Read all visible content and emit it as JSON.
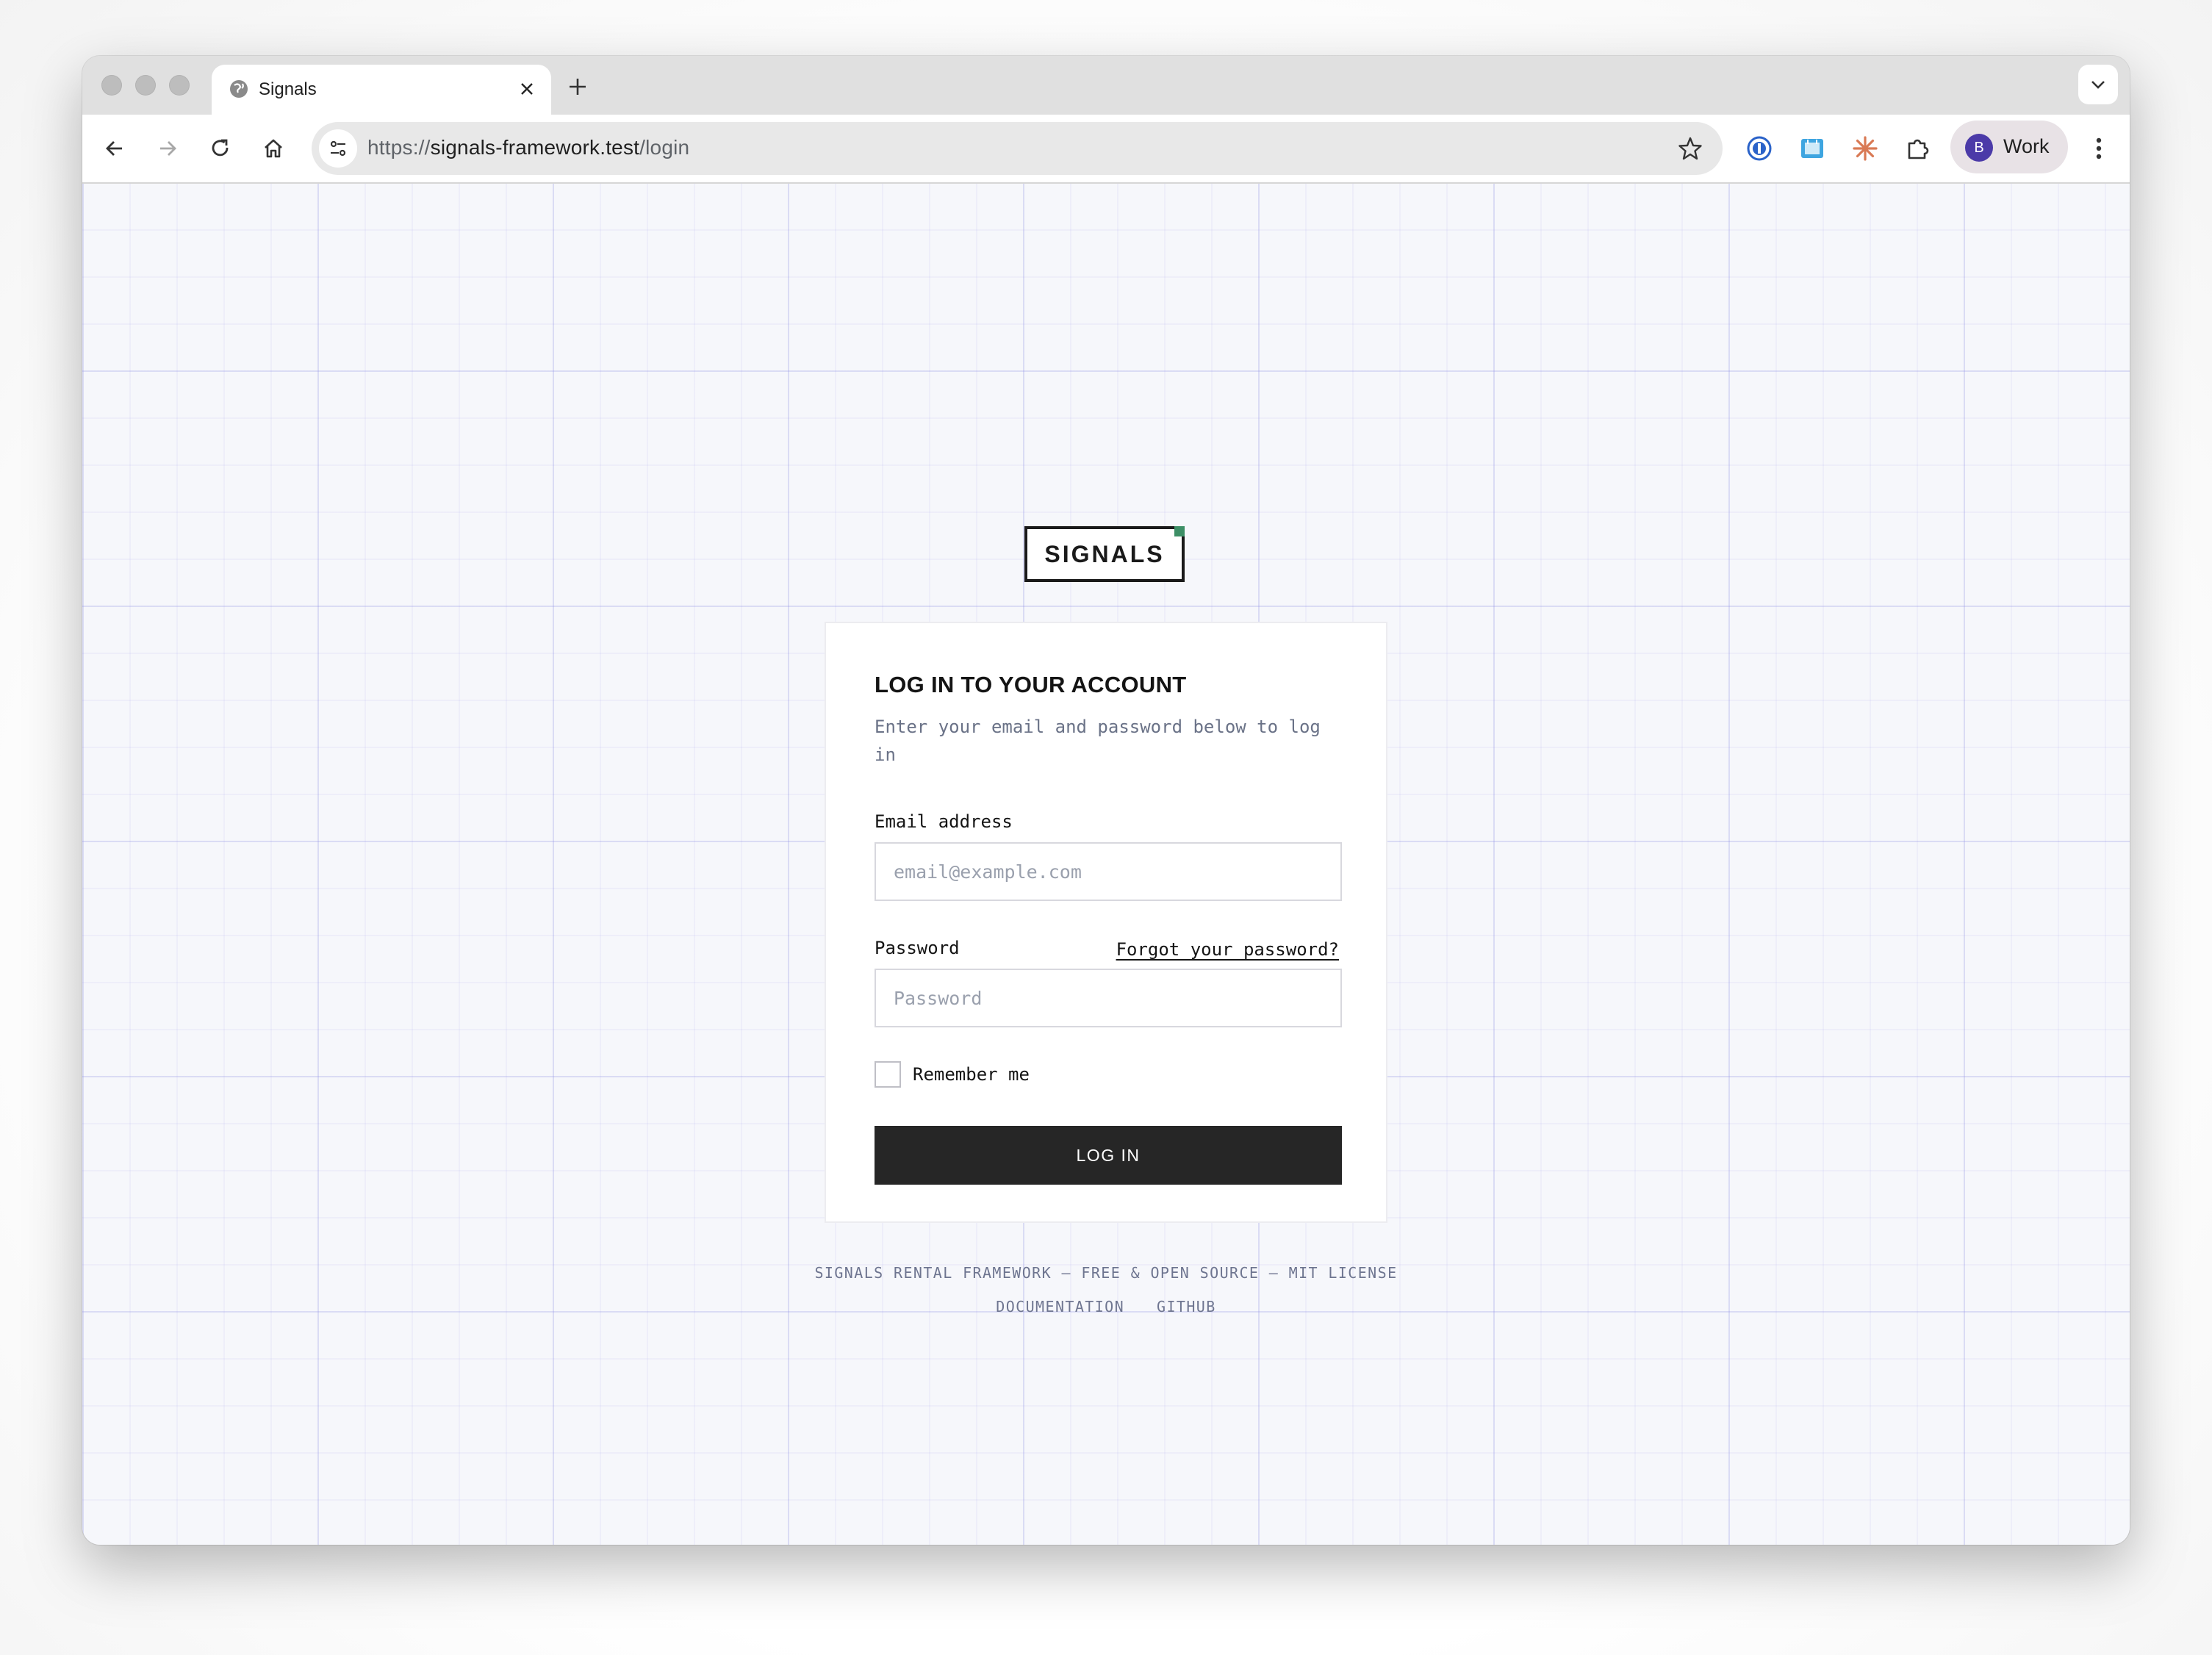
{
  "browser": {
    "tab_title": "Signals",
    "url_scheme": "https://",
    "url_host": "signals-framework.test",
    "url_path": "/login",
    "profile_initial": "B",
    "profile_name": "Work"
  },
  "page": {
    "logo_text": "SIGNALS",
    "login": {
      "title": "LOG IN TO YOUR ACCOUNT",
      "description": "Enter your email and password below to log in",
      "email_label": "Email address",
      "email_placeholder": "email@example.com",
      "password_label": "Password",
      "password_placeholder": "Password",
      "forgot_link": "Forgot your password?",
      "remember_label": "Remember me",
      "submit_label": "LOG IN"
    },
    "footer": {
      "tagline": "SIGNALS RENTAL FRAMEWORK — FREE & OPEN SOURCE — MIT LICENSE",
      "links": [
        "DOCUMENTATION",
        "GITHUB"
      ]
    }
  },
  "colors": {
    "brand_dot": "#3d8f66",
    "button_bg": "#262626",
    "avatar": "#4b3aa8"
  }
}
